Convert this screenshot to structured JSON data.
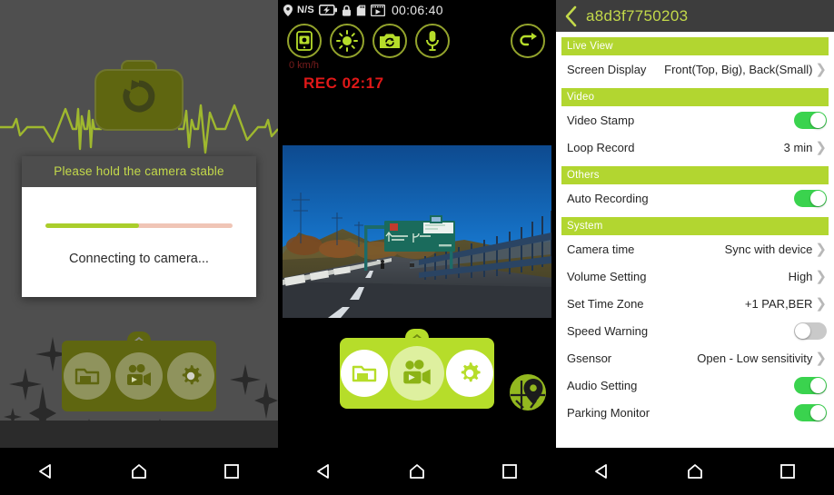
{
  "panel_connect": {
    "dialog": {
      "title": "Please hold the camera stable",
      "message": "Connecting to camera...",
      "progress_percent": 50
    },
    "hero_icon": "camera-refresh-icon",
    "toolbar": [
      {
        "name": "folder-icon",
        "label": "Files"
      },
      {
        "name": "video-camera-icon",
        "label": "Live"
      },
      {
        "name": "gear-icon",
        "label": "Settings"
      }
    ],
    "colors": {
      "accent": "#b6dd2a",
      "dim_accent": "#5f6610",
      "background": "#4f4f4f"
    }
  },
  "panel_live": {
    "status_bar": {
      "gps_label": "N/S",
      "icons": [
        "gps-pin-icon",
        "battery-charging-icon",
        "lock-icon",
        "sdcard-icon",
        "film-icon"
      ],
      "time": "00:06:40"
    },
    "tool_icons": [
      {
        "name": "snapshot-to-phone-icon",
        "label": "Snapshot"
      },
      {
        "name": "brightness-icon",
        "label": "Brightness"
      },
      {
        "name": "switch-camera-icon",
        "label": "Switch Camera"
      },
      {
        "name": "microphone-icon",
        "label": "Microphone"
      }
    ],
    "back_icon": "back-arrow-icon",
    "speed": "0 km/h",
    "recording": "REC 02:17",
    "toolbar": [
      {
        "name": "folder-icon",
        "label": "Files"
      },
      {
        "name": "video-camera-icon",
        "label": "Live"
      },
      {
        "name": "gear-icon",
        "label": "Settings"
      }
    ],
    "gps_badge_icon": "map-pin-icon",
    "colors": {
      "accent": "#b6dd2a",
      "rec": "#e01818",
      "speed": "#7a1d1d"
    }
  },
  "panel_settings": {
    "header": {
      "back_icon": "back-chevron-icon",
      "title": "a8d3f7750203"
    },
    "sections": [
      {
        "title": "Live View",
        "rows": [
          {
            "label": "Screen Display",
            "value": "Front(Top, Big), Back(Small)",
            "control": "chevron"
          }
        ]
      },
      {
        "title": "Video",
        "rows": [
          {
            "label": "Video Stamp",
            "value": "",
            "control": "toggle",
            "state": "on"
          },
          {
            "label": "Loop Record",
            "value": "3 min",
            "control": "chevron"
          }
        ]
      },
      {
        "title": "Others",
        "rows": [
          {
            "label": "Auto Recording",
            "value": "",
            "control": "toggle",
            "state": "on"
          }
        ]
      },
      {
        "title": "System",
        "rows": [
          {
            "label": "Camera time",
            "value": "Sync with device",
            "control": "chevron"
          },
          {
            "label": "Volume Setting",
            "value": "High",
            "control": "chevron"
          },
          {
            "label": "Set Time Zone",
            "value": "+1 PAR,BER",
            "control": "chevron"
          },
          {
            "label": "Speed Warning",
            "value": "",
            "control": "toggle",
            "state": "off"
          },
          {
            "label": "Gsensor",
            "value": "Open - Low sensitivity",
            "control": "chevron"
          },
          {
            "label": "Audio Setting",
            "value": "",
            "control": "toggle",
            "state": "on"
          },
          {
            "label": "Parking Monitor",
            "value": "",
            "control": "toggle",
            "state": "on"
          }
        ]
      }
    ],
    "colors": {
      "section_header": "#b2d630",
      "toggle_on": "#3ad34e",
      "toggle_off": "#c9c9c9",
      "header_bg": "#3d3d3d",
      "title": "#c3d94a"
    }
  },
  "navbar": {
    "items": [
      {
        "name": "back-nav-icon",
        "label": "Back"
      },
      {
        "name": "home-nav-icon",
        "label": "Home"
      },
      {
        "name": "recents-nav-icon",
        "label": "Recents"
      }
    ]
  }
}
